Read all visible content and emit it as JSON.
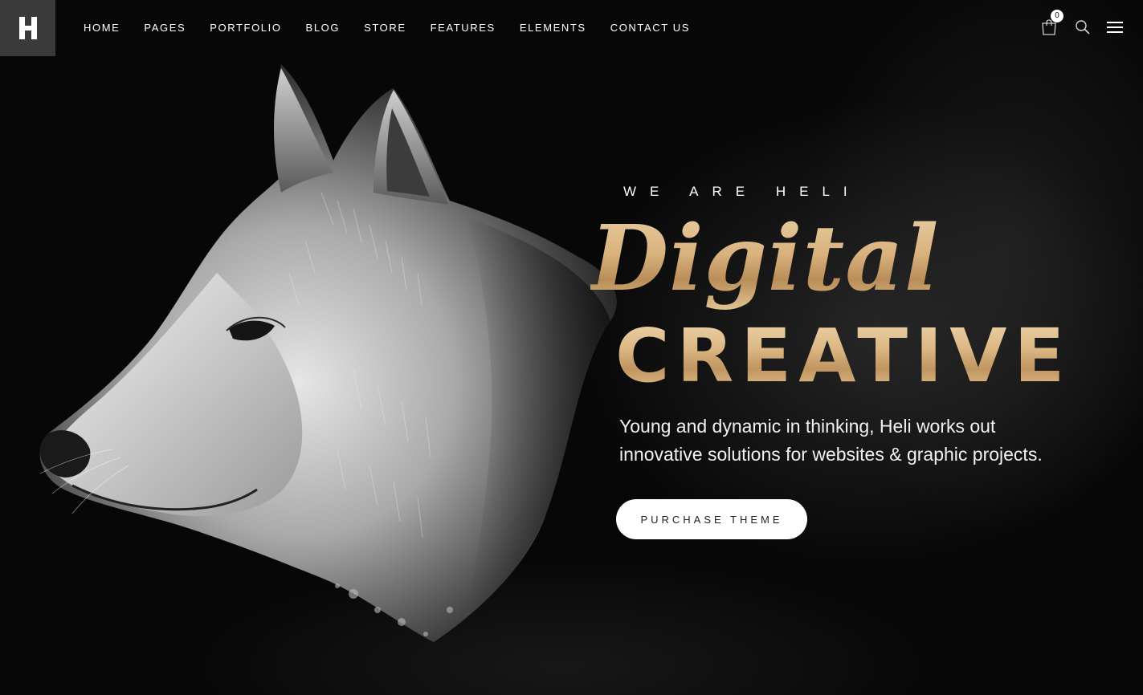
{
  "header": {
    "logo_letter": "H",
    "nav": [
      {
        "label": "HOME"
      },
      {
        "label": "PAGES"
      },
      {
        "label": "PORTFOLIO"
      },
      {
        "label": "BLOG"
      },
      {
        "label": "STORE"
      },
      {
        "label": "FEATURES"
      },
      {
        "label": "ELEMENTS"
      },
      {
        "label": "CONTACT US"
      }
    ],
    "cart_count": "0",
    "icons": [
      "cart-icon",
      "search-icon",
      "hamburger-menu-icon"
    ]
  },
  "hero": {
    "eyebrow": "WE ARE HELI",
    "title_script": "Digital",
    "title_bold": "CREATIVE",
    "description_lines": [
      "Young and dynamic in thinking, Heli works out",
      "innovative solutions for websites & graphic projects."
    ],
    "cta_label": "PURCHASE THEME"
  },
  "colors": {
    "background": "#070707",
    "logo_box": "#3a3a3a",
    "gold_accent": "#d9b27e",
    "text": "#ffffff",
    "button_bg": "#ffffff",
    "button_text": "#222222"
  }
}
